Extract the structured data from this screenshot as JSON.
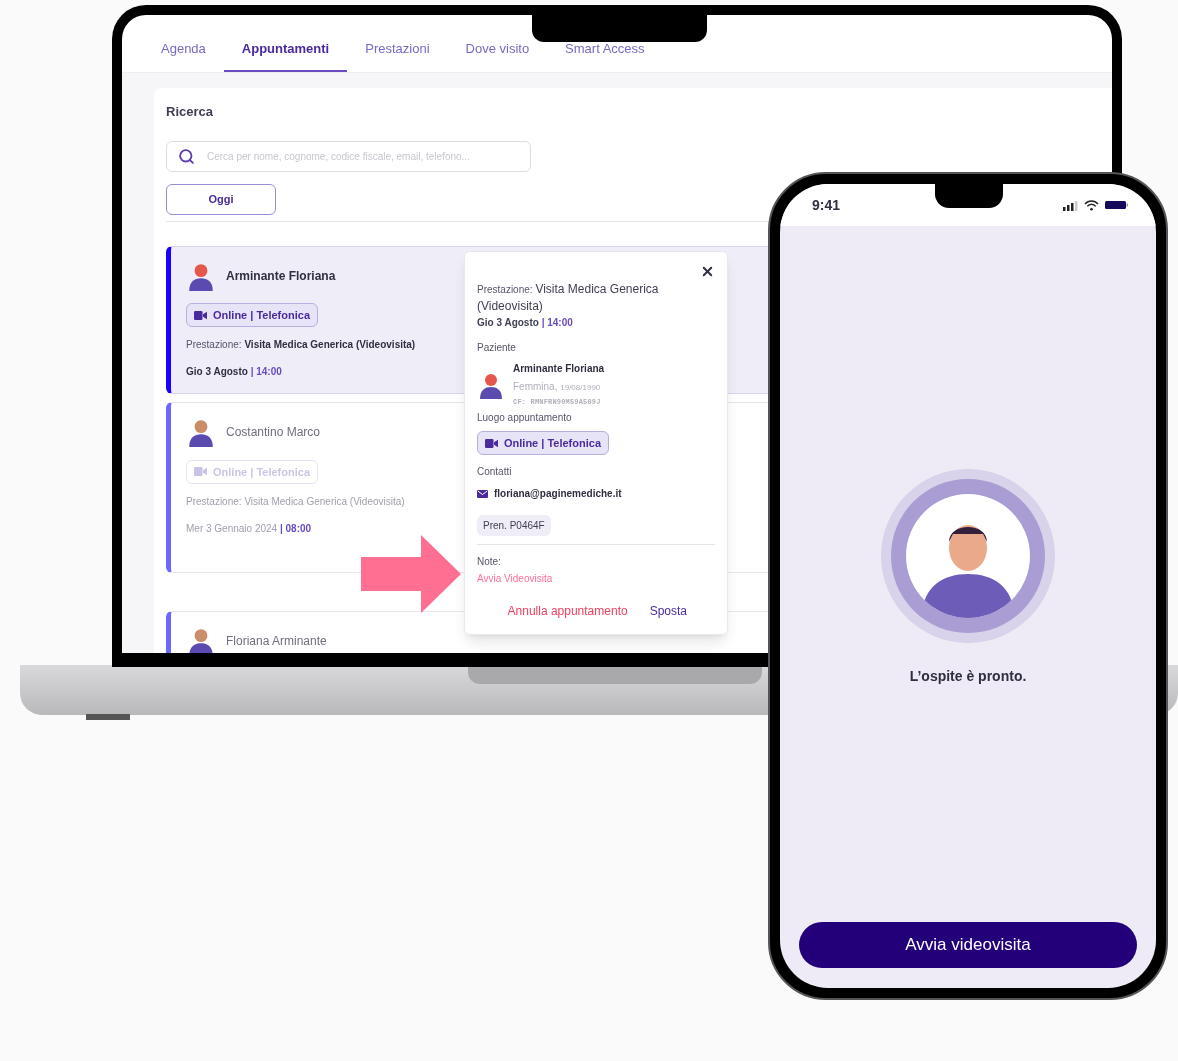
{
  "laptop": {
    "tabs": [
      {
        "label": "Agenda",
        "selected": false
      },
      {
        "label": "Appuntamenti",
        "selected": true
      },
      {
        "label": "Prestazioni",
        "selected": false
      },
      {
        "label": "Dove visito",
        "selected": false
      },
      {
        "label": "Smart Access",
        "selected": false
      }
    ],
    "search": {
      "title": "Ricerca",
      "placeholder": "Cerca per nome, cognome, codice fiscale, email, telefono..."
    },
    "today_button": "Oggi",
    "appointments": [
      {
        "name": "Arminante Floriana",
        "selected": true,
        "location": "Online | Telefonica",
        "service_label": "Prestazione:",
        "service": "Visita Medica Generica (Videovisita)",
        "date": "Gio 3 Agosto",
        "time": "| 14:00"
      },
      {
        "name": "Costantino Marco",
        "selected": false,
        "location": "Online | Telefonica",
        "service_label": "Prestazione:",
        "service": "Visita Medica Generica (Videovisita)",
        "date": "Mer 3 Gennaio 2024",
        "time": "| 08:00"
      },
      {
        "name": "Floriana Arminante",
        "selected": false
      }
    ],
    "popup": {
      "service_label": "Prestazione:",
      "service": "Visita Medica Generica (Videovisita)",
      "date": "Gio 3 Agosto",
      "time": "| 14:00",
      "patient_label": "Paziente",
      "patient_name": "Arminante Floriana",
      "gender": "Femmina,",
      "birth_date": "19/08/1990",
      "tax_code": "CF: RMNFRN90M59A509J",
      "location_label": "Luogo appuntamento",
      "location": "Online | Telefonica",
      "contacts_label": "Contatti",
      "email": "floriana@paginemediche.it",
      "booking": "Pren. P0464F",
      "notes_label": "Note:",
      "note": "Avvia Videovisita",
      "actions": [
        {
          "label": "Annulla appuntamento",
          "kind": "danger"
        },
        {
          "label": "Sposta",
          "kind": "primary"
        }
      ]
    }
  },
  "phone": {
    "time": "9:41",
    "message": "L’ospite è pronto.",
    "button": "Avvia videovisita"
  }
}
